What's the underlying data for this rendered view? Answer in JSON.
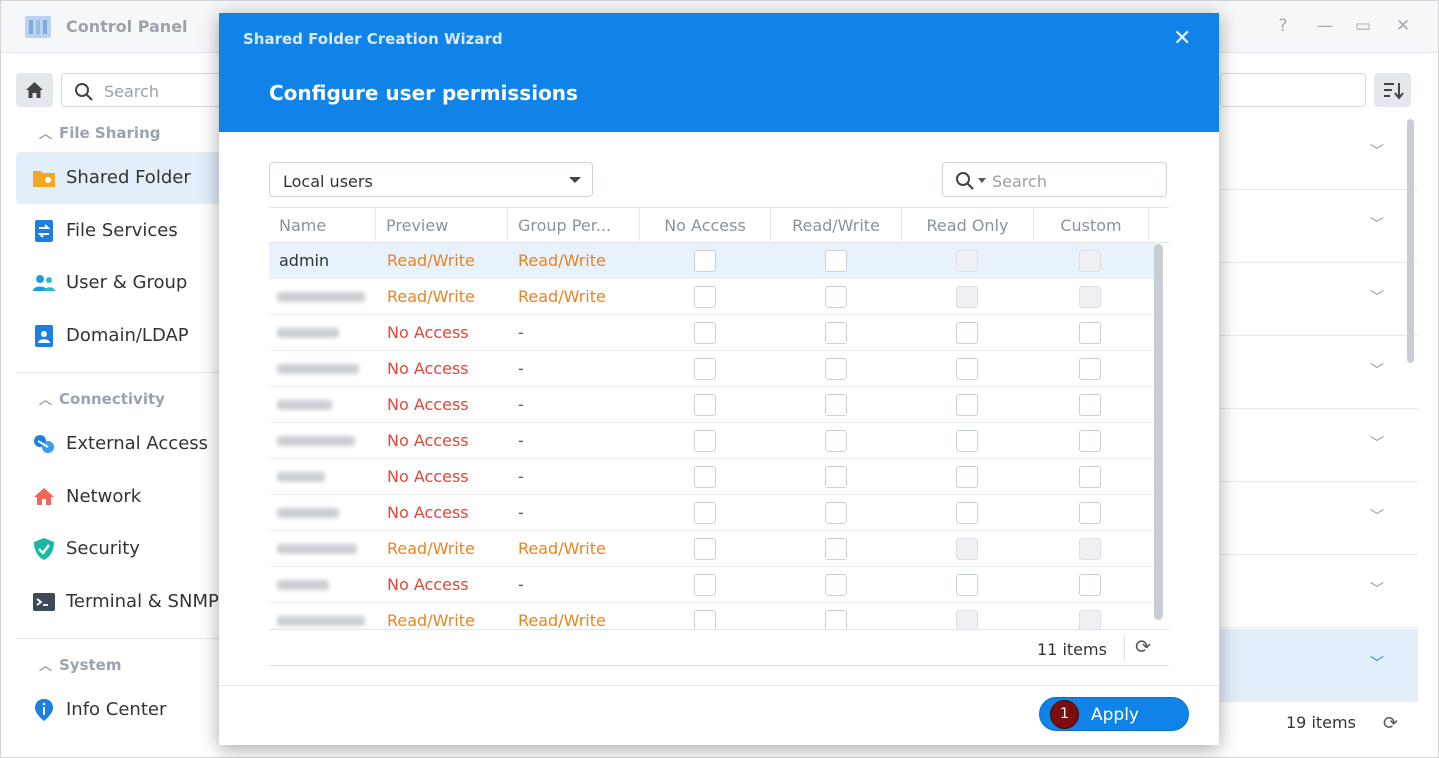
{
  "control_panel": {
    "title": "Control Panel",
    "search_placeholder": "Search",
    "help_icon": "?",
    "minimize_icon": "—",
    "maximize_icon": "▭",
    "close_icon": "✕",
    "sections": [
      {
        "label": "File Sharing",
        "items": [
          "Shared Folder",
          "File Services",
          "User & Group",
          "Domain/LDAP"
        ]
      },
      {
        "label": "Connectivity",
        "items": [
          "External Access",
          "Network",
          "Security",
          "Terminal & SNMP"
        ]
      },
      {
        "label": "System",
        "items": [
          "Info Center"
        ]
      }
    ],
    "active_item": "Shared Folder",
    "footer_count": "19 items"
  },
  "wizard": {
    "window_title": "Shared Folder Creation Wizard",
    "step_title": "Configure user permissions",
    "user_type": "Local users",
    "search_placeholder": "Search",
    "columns": [
      "Name",
      "Preview",
      "Group Per...",
      "No Access",
      "Read/Write",
      "Read Only",
      "Custom"
    ],
    "rows": [
      {
        "name": "admin",
        "preview": "Read/Write",
        "group": "Read/Write",
        "ro_disabled": true,
        "custom_disabled": true
      },
      {
        "name": "",
        "preview": "Read/Write",
        "group": "Read/Write",
        "ro_disabled": true,
        "custom_disabled": true
      },
      {
        "name": "",
        "preview": "No Access",
        "group": "-",
        "ro_disabled": false,
        "custom_disabled": false
      },
      {
        "name": "",
        "preview": "No Access",
        "group": "-",
        "ro_disabled": false,
        "custom_disabled": false
      },
      {
        "name": "",
        "preview": "No Access",
        "group": "-",
        "ro_disabled": false,
        "custom_disabled": false
      },
      {
        "name": "",
        "preview": "No Access",
        "group": "-",
        "ro_disabled": false,
        "custom_disabled": false
      },
      {
        "name": "",
        "preview": "No Access",
        "group": "-",
        "ro_disabled": false,
        "custom_disabled": false
      },
      {
        "name": "",
        "preview": "No Access",
        "group": "-",
        "ro_disabled": false,
        "custom_disabled": false
      },
      {
        "name": "",
        "preview": "Read/Write",
        "group": "Read/Write",
        "ro_disabled": true,
        "custom_disabled": true
      },
      {
        "name": "",
        "preview": "No Access",
        "group": "-",
        "ro_disabled": false,
        "custom_disabled": false
      },
      {
        "name": "",
        "preview": "Read/Write",
        "group": "Read/Write",
        "ro_disabled": true,
        "custom_disabled": true
      }
    ],
    "items_count": "11 items",
    "apply_label": "Apply",
    "apply_badge": "1",
    "close_icon": "✕"
  },
  "colors": {
    "accent": "#1083e8",
    "read_write": "#e8841f",
    "no_access": "#e0463a",
    "badge": "#7d0e10"
  }
}
